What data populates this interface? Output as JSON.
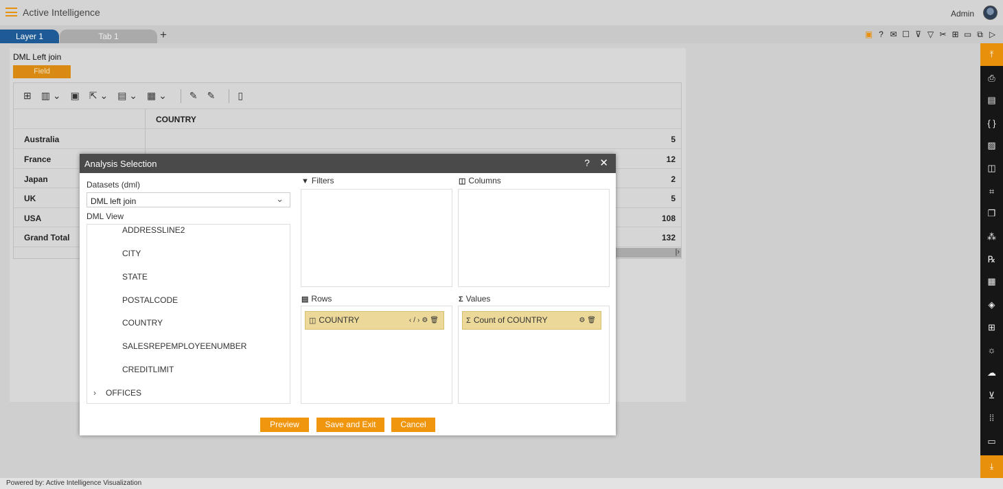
{
  "app": {
    "title": "Active Intelligence",
    "user": "Admin"
  },
  "tabs": {
    "items": [
      {
        "label": "Layer 1"
      },
      {
        "label": "Tab 1"
      }
    ],
    "add": "+"
  },
  "toolbar_icons": [
    "save-icon",
    "help-icon",
    "mail-icon",
    "comment-icon",
    "clear-filter-icon",
    "filter-icon",
    "tools-icon",
    "table-icon",
    "presentation-icon",
    "copy-window-icon",
    "play-icon"
  ],
  "sidebar_icons": [
    "collapse-up-icon",
    "currency-icon",
    "document-icon",
    "braces-icon",
    "image-icon",
    "report-icon",
    "chart-icon",
    "pages-icon",
    "cluster-icon",
    "rx-icon",
    "list-icon",
    "layers-icon",
    "widgets-icon",
    "alert-icon",
    "cloud-upload-icon",
    "cart-icon",
    "grid-icon",
    "display-icon",
    "collapse-down-icon"
  ],
  "panel": {
    "title": "DML Left join",
    "field_button": "Field",
    "pivot": {
      "column_header": "COUNTRY",
      "rows": [
        {
          "label": "Australia",
          "value": "5"
        },
        {
          "label": "France",
          "value": "12"
        },
        {
          "label": "Japan",
          "value": "2"
        },
        {
          "label": "UK",
          "value": "5"
        },
        {
          "label": "USA",
          "value": "108"
        },
        {
          "label": "Grand Total",
          "value": "132"
        }
      ]
    }
  },
  "modal": {
    "title": "Analysis Selection",
    "help": "?",
    "close": "✕",
    "datasets_label": "Datasets (dml)",
    "dataset_value": "DML left join",
    "view_label": "DML View",
    "tree_items": [
      "ADDRESSLINE2",
      "CITY",
      "STATE",
      "POSTALCODE",
      "COUNTRY",
      "SALESREPEMPLOYEENUMBER",
      "CREDITLIMIT"
    ],
    "tree_group": "OFFICES",
    "filters_label": "Filters",
    "columns_label": "Columns",
    "rows_label": "Rows",
    "values_label": "Values",
    "row_chip": "COUNTRY",
    "value_chip": "Count of COUNTRY",
    "buttons": {
      "preview": "Preview",
      "save": "Save and Exit",
      "cancel": "Cancel"
    }
  },
  "footer": "Powered by: Active Intelligence Visualization",
  "colors": {
    "accent": "#f0960e",
    "tab_active": "#1d5a96",
    "modal_header": "#4a4a4a",
    "chip": "#ecd99a"
  }
}
